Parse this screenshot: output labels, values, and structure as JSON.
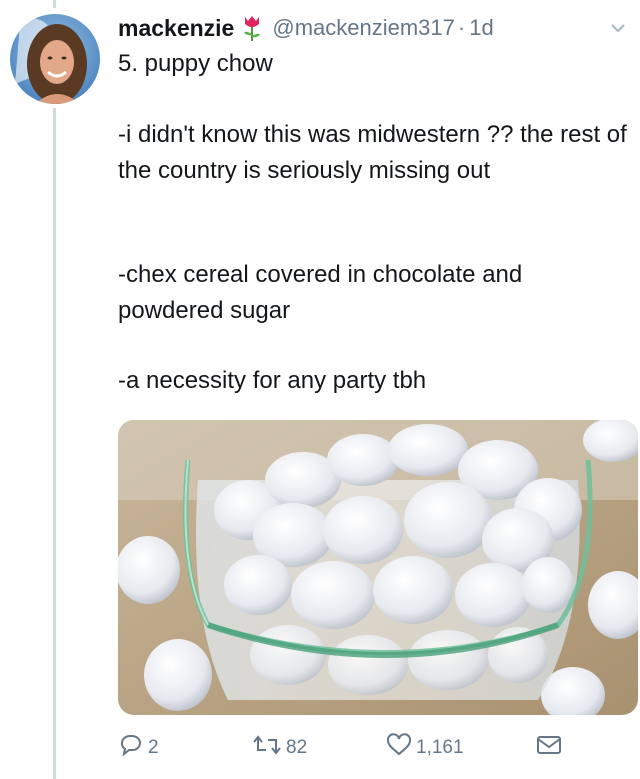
{
  "tweet": {
    "display_name": "mackenzie",
    "handle": "@mackenziem317",
    "separator": "·",
    "time": "1d",
    "text_line_1": "5. puppy chow",
    "text_para_2": "-i didn't know this was midwestern ?? the rest of the country is seriously missing out",
    "text_para_3": "-chex cereal covered in chocolate and powdered sugar",
    "text_para_4": "-a necessity for any party tbh",
    "media_alt": "puppy chow in glass jar"
  },
  "actions": {
    "reply_count": "2",
    "retweet_count": "82",
    "like_count": "1,161"
  },
  "colors": {
    "muted": "#657786",
    "text": "#14171a",
    "thread_line": "#cfd9de"
  },
  "icons": [
    "rose-icon",
    "chevron-down-icon",
    "reply-icon",
    "retweet-icon",
    "like-icon",
    "direct-message-icon"
  ]
}
